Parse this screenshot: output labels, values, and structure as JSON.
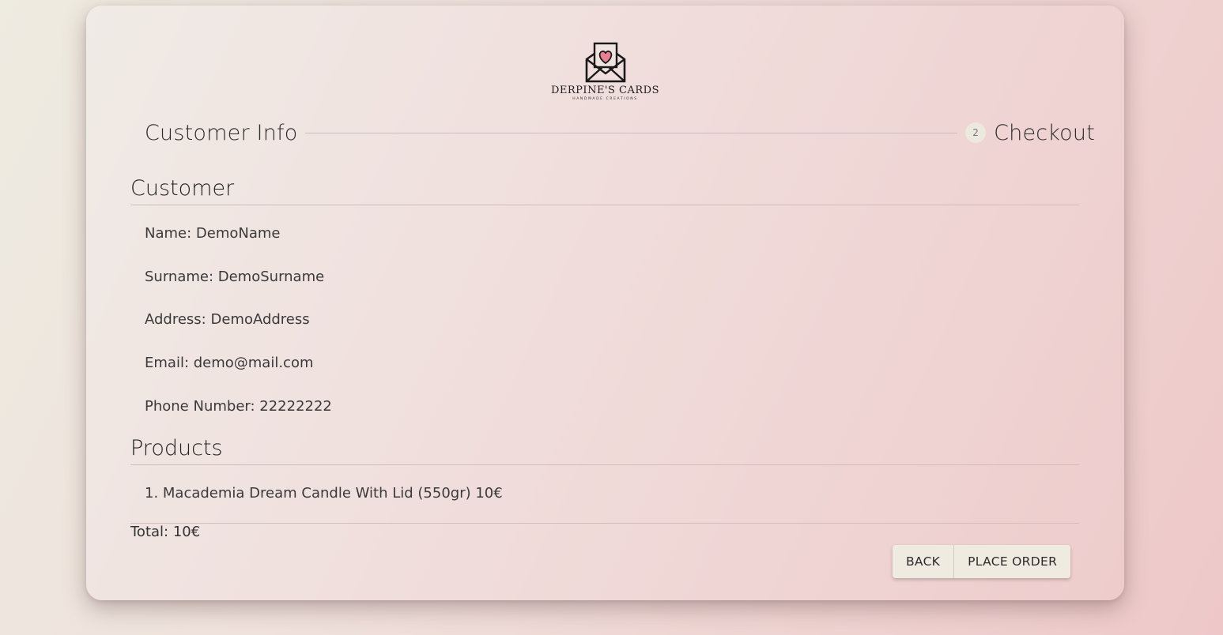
{
  "brand": {
    "name": "DERPINE'S CARDS",
    "tagline": "HANDMADE CREATIONS",
    "logo_icon": "envelope-heart-icon",
    "heart_color": "#e97f92"
  },
  "stepper": {
    "step1_label": "Customer Info",
    "step2_number": "2",
    "step2_label": "Checkout"
  },
  "customer": {
    "title": "Customer",
    "name": "Name: DemoName",
    "surname": "Surname: DemoSurname",
    "address": "Address: DemoAddress",
    "email": "Email: demo@mail.com",
    "phone": "Phone Number: 22222222"
  },
  "products": {
    "title": "Products",
    "items": [
      "1. Macademia Dream Candle With Lid (550gr) 10€"
    ]
  },
  "total": "Total: 10€",
  "actions": {
    "back_label": "BACK",
    "place_order_label": "PLACE ORDER"
  }
}
